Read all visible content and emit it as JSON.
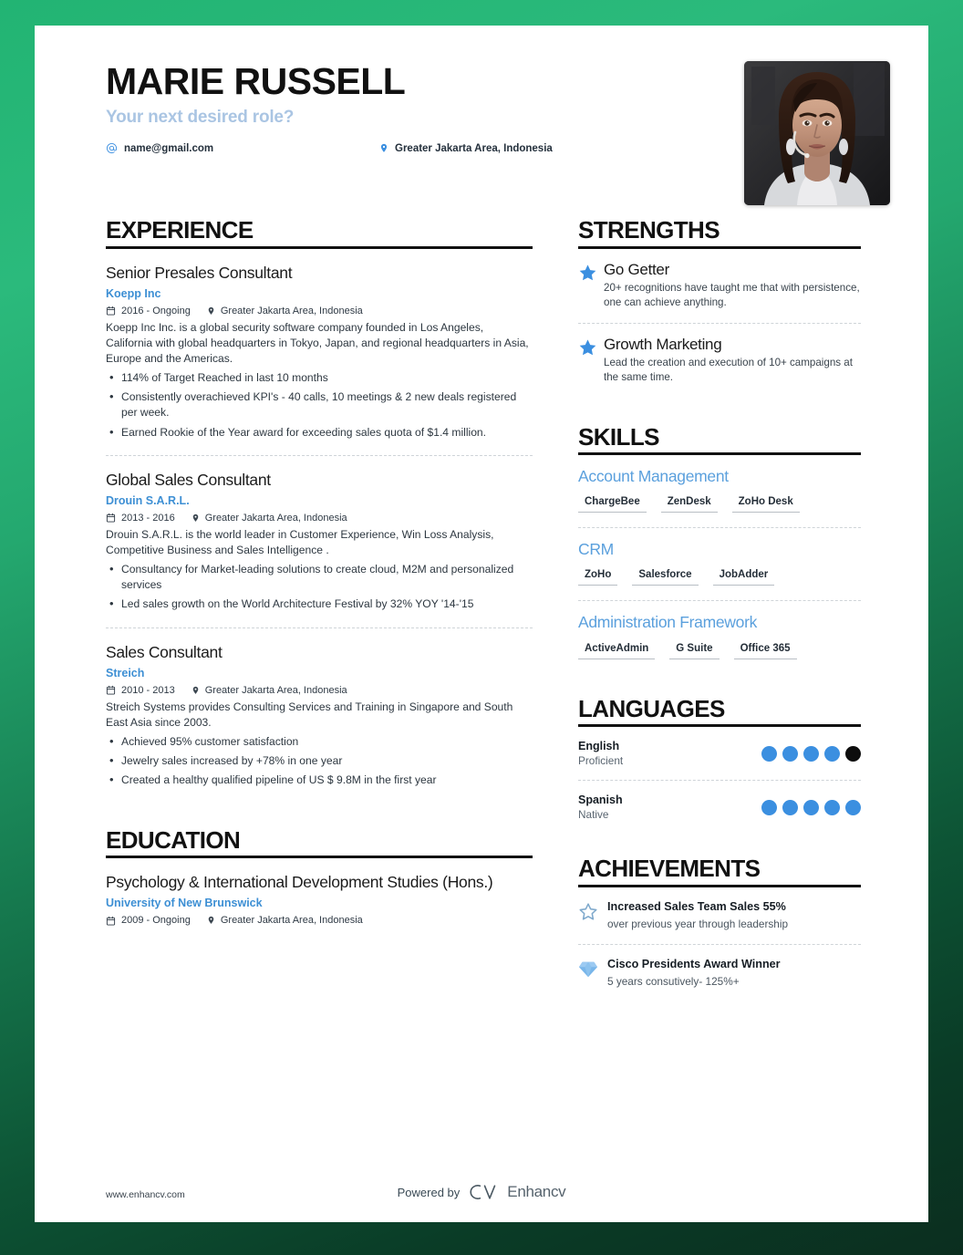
{
  "header": {
    "name": "MARIE RUSSELL",
    "subtitle": "Your next desired role?",
    "email": "name@gmail.com",
    "location": "Greater Jakarta Area, Indonesia"
  },
  "experience": {
    "heading": "EXPERIENCE",
    "entries": [
      {
        "title": "Senior Presales Consultant",
        "org": "Koepp Inc",
        "dates": "2016 - Ongoing",
        "location": "Greater Jakarta Area, Indonesia",
        "description": "Koepp Inc Inc. is a global security software company founded in Los Angeles, California with global headquarters in Tokyo, Japan, and regional headquarters in Asia, Europe and the Americas.",
        "bullets": [
          "114% of Target Reached in last 10 months",
          "Consistently overachieved KPI's - 40 calls, 10 meetings & 2 new deals registered per week.",
          "Earned Rookie of the Year award for exceeding sales quota of $1.4 million."
        ]
      },
      {
        "title": "Global Sales Consultant",
        "org": "Drouin S.A.R.L.",
        "dates": "2013 - 2016",
        "location": "Greater Jakarta Area, Indonesia",
        "description": "Drouin S.A.R.L. is the world leader in Customer Experience, Win Loss Analysis, Competitive Business and Sales Intelligence .",
        "bullets": [
          "Consultancy for Market-leading solutions to create cloud, M2M and personalized services",
          "Led sales growth on the World Architecture Festival by 32% YOY '14-'15"
        ]
      },
      {
        "title": "Sales Consultant",
        "org": "Streich",
        "dates": "2010 - 2013",
        "location": "Greater Jakarta Area, Indonesia",
        "description": "Streich Systems provides Consulting Services and Training in Singapore and South East Asia since 2003.",
        "bullets": [
          "Achieved 95% customer satisfaction",
          "Jewelry sales increased by +78% in one year",
          "Created a healthy qualified pipeline of US $ 9.8M in the first year"
        ]
      }
    ]
  },
  "education": {
    "heading": "EDUCATION",
    "entries": [
      {
        "title": "Psychology & International Development Studies (Hons.)",
        "org": "University of New Brunswick",
        "dates": "2009 - Ongoing",
        "location": "Greater Jakarta Area, Indonesia"
      }
    ]
  },
  "strengths": {
    "heading": "STRENGTHS",
    "items": [
      {
        "icon": "star-filled-icon",
        "title": "Go Getter",
        "description": "20+ recognitions have taught me that with persistence, one can achieve anything."
      },
      {
        "icon": "star-filled-icon",
        "title": "Growth Marketing",
        "description": "Lead the creation and execution of 10+ campaigns at the same time."
      }
    ]
  },
  "skills": {
    "heading": "SKILLS",
    "groups": [
      {
        "name": "Account Management",
        "tags": [
          "ChargeBee",
          "ZenDesk",
          "ZoHo Desk"
        ]
      },
      {
        "name": "CRM",
        "tags": [
          "ZoHo",
          "Salesforce",
          "JobAdder"
        ]
      },
      {
        "name": "Administration Framework",
        "tags": [
          "ActiveAdmin",
          "G Suite",
          "Office 365"
        ]
      }
    ]
  },
  "languages": {
    "heading": "LANGUAGES",
    "items": [
      {
        "name": "English",
        "level": "Proficient",
        "dots": [
          "blue",
          "blue",
          "blue",
          "blue",
          "dark"
        ]
      },
      {
        "name": "Spanish",
        "level": "Native",
        "dots": [
          "blue",
          "blue",
          "blue",
          "blue",
          "blue"
        ]
      }
    ]
  },
  "achievements": {
    "heading": "ACHIEVEMENTS",
    "items": [
      {
        "icon": "star-outline-icon",
        "title": "Increased Sales Team Sales 55%",
        "description": "over previous year through leadership"
      },
      {
        "icon": "diamond-icon",
        "title": "Cisco Presidents Award Winner",
        "description": "5 years consutively- 125%+"
      }
    ]
  },
  "footer": {
    "url": "www.enhancv.com",
    "powered_by": "Powered by",
    "brand": "Enhancv"
  },
  "colors": {
    "accent_blue": "#3b8fe0",
    "link_blue": "#3d8fd4",
    "subtitle_blue": "#aac5e3",
    "heading_black": "#111111",
    "border_green_light": "#2bba7c",
    "border_green_dark": "#0b2e1f"
  }
}
